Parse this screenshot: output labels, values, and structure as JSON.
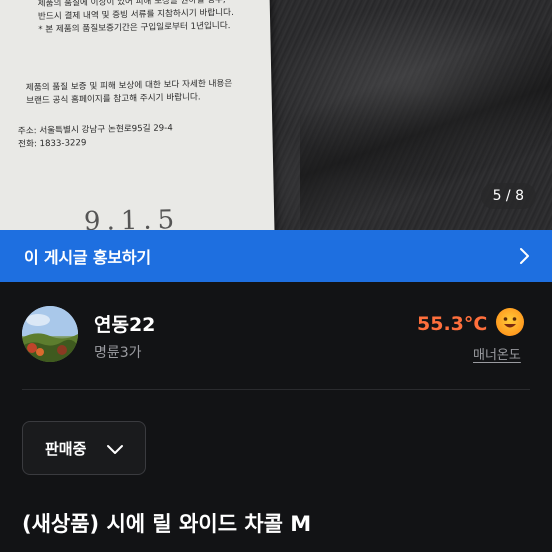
{
  "photo": {
    "tag_lines_top": [
      "제품의 품질에 이상이 있어 피해 보상을 원하실 경우,",
      "반드시 결제 내역 및 증빙 서류를 지참하시기 바랍니다.",
      "* 본 제품의 품질보증기간은 구입일로부터 1년입니다."
    ],
    "tag_lines_middle": [
      "제품의 품질 보증 및 피해 보상에 대한 보다 자세한 내용은",
      "브랜드 공식 홈페이지를 참고해 주시기 바랍니다."
    ],
    "address": "주소: 서울특별시 강남구 논현로95길 29-4",
    "phone": "전화: 1833-3229",
    "tag_bottom_text": "9.1.5",
    "counter": "5 / 8"
  },
  "promote": {
    "label": "이 게시글 홍보하기"
  },
  "seller": {
    "name": "연동22",
    "subtitle": "명륜3가",
    "temperature": "55.3°C",
    "manner_label": "매너온도"
  },
  "status": {
    "selected": "판매중"
  },
  "post": {
    "title": "(새상품) 시에 릴 와이드 차콜 M"
  },
  "colors": {
    "background": "#121315",
    "promote_bar": "#1e6fe0",
    "temperature": "#ff6f3c",
    "muted_text": "#9a9ba0"
  }
}
